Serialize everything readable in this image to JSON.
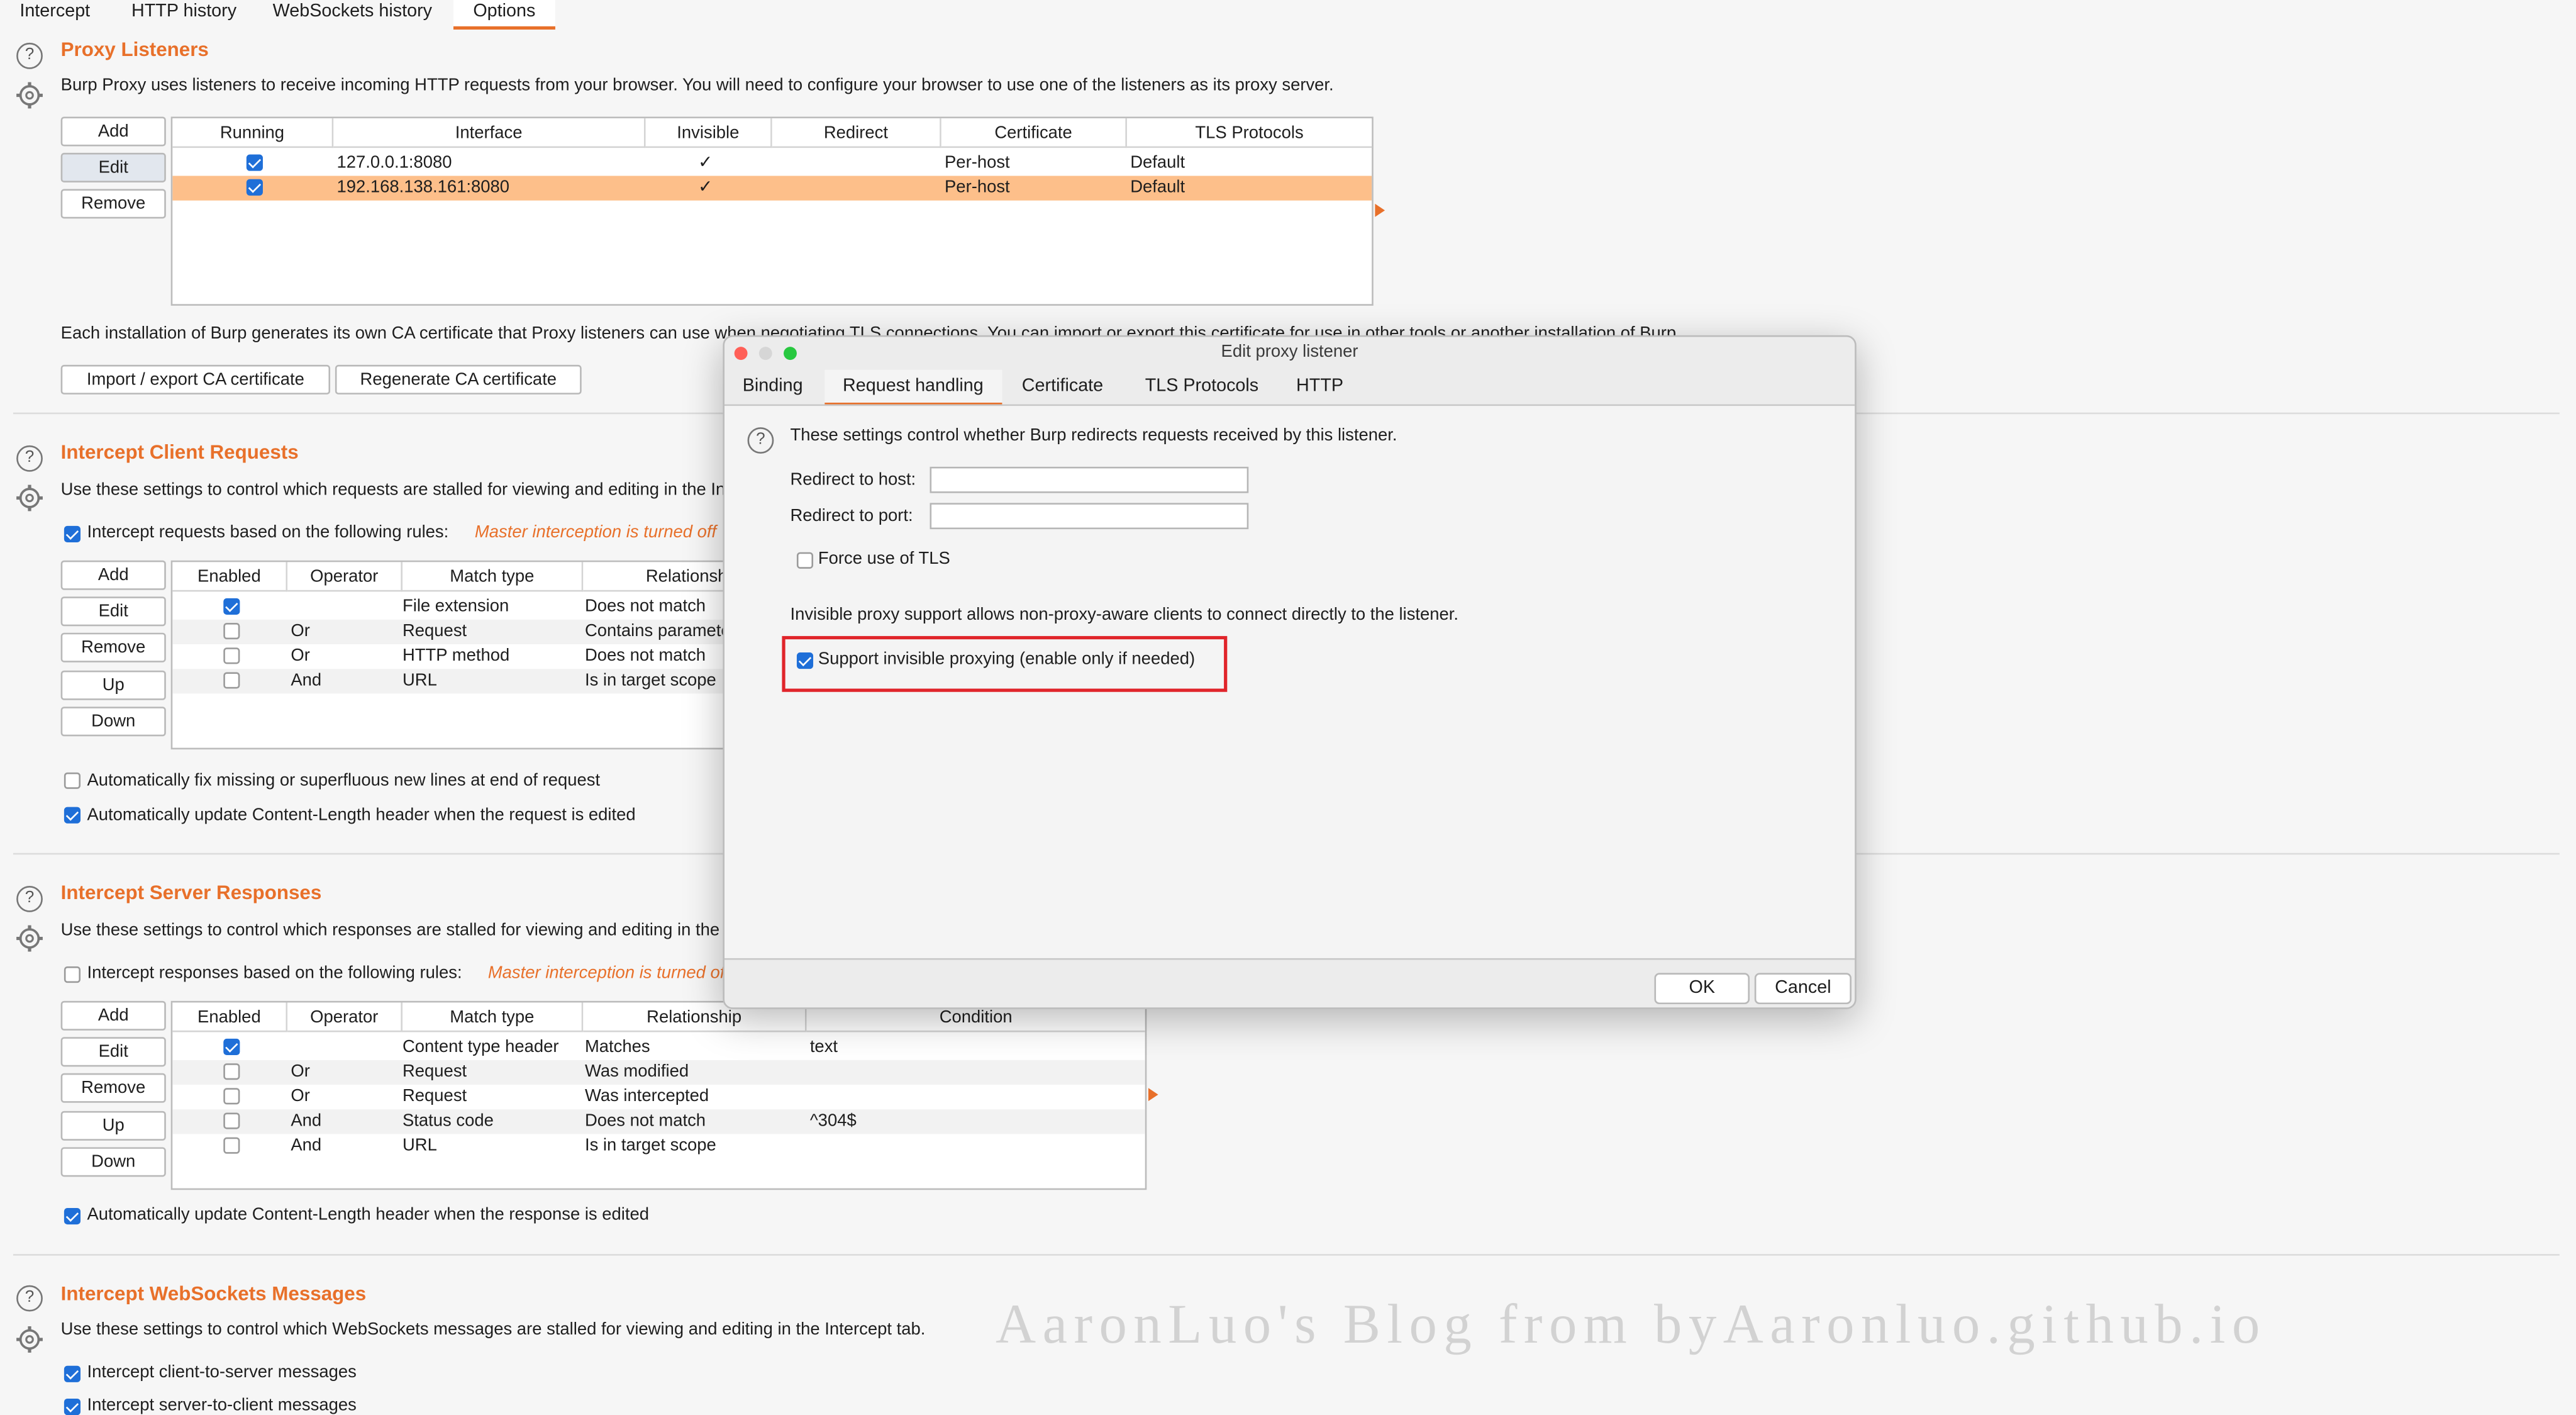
{
  "tabs": [
    "Intercept",
    "HTTP history",
    "WebSockets history",
    "Options"
  ],
  "proxy_listeners": {
    "title": "Proxy Listeners",
    "description": "Burp Proxy uses listeners to receive incoming HTTP requests from your browser. You will need to configure your browser to use one of the listeners as its proxy server.",
    "buttons": [
      "Add",
      "Edit",
      "Remove"
    ],
    "columns": [
      "Running",
      "Interface",
      "Invisible",
      "Redirect",
      "Certificate",
      "TLS Protocols"
    ],
    "rows": [
      {
        "running": true,
        "interface": "127.0.0.1:8080",
        "invisible": "✓",
        "redirect": "",
        "certificate": "Per-host",
        "tls": "Default"
      },
      {
        "running": true,
        "interface": "192.168.138.161:8080",
        "invisible": "✓",
        "redirect": "",
        "certificate": "Per-host",
        "tls": "Default"
      }
    ],
    "ca_text": "Each installation of Burp generates its own CA certificate that Proxy listeners can use when negotiating TLS connections. You can import or export this certificate for use in other tools or another installation of Burp.",
    "import_export_label": "Import / export CA certificate",
    "regenerate_label": "Regenerate CA certificate"
  },
  "intercept_client": {
    "title": "Intercept Client Requests",
    "description": "Use these settings to control which requests are stalled for viewing and editing in the Intercept tab.",
    "rule_label": "Intercept requests based on the following rules:",
    "master_note": "Master interception is turned off",
    "buttons": [
      "Add",
      "Edit",
      "Remove",
      "Up",
      "Down"
    ],
    "columns": [
      "Enabled",
      "Operator",
      "Match type",
      "Relationship"
    ],
    "rows": [
      {
        "enabled": true,
        "operator": "",
        "match": "File extension",
        "rel": "Does not match"
      },
      {
        "enabled": false,
        "operator": "Or",
        "match": "Request",
        "rel": "Contains parameters"
      },
      {
        "enabled": false,
        "operator": "Or",
        "match": "HTTP method",
        "rel": "Does not match"
      },
      {
        "enabled": false,
        "operator": "And",
        "match": "URL",
        "rel": "Is in target scope"
      }
    ],
    "fix_newlines": "Automatically fix missing or superfluous new lines at end of request",
    "update_cl": "Automatically update Content-Length header when the request is edited"
  },
  "intercept_server": {
    "title": "Intercept Server Responses",
    "description": "Use these settings to control which responses are stalled for viewing and editing in the Intercept tab.",
    "rule_label": "Intercept responses based on the following rules:",
    "master_note": "Master interception is turned off",
    "buttons": [
      "Add",
      "Edit",
      "Remove",
      "Up",
      "Down"
    ],
    "columns": [
      "Enabled",
      "Operator",
      "Match type",
      "Relationship",
      "Condition"
    ],
    "rows": [
      {
        "enabled": true,
        "operator": "",
        "match": "Content type header",
        "rel": "Matches",
        "cond": "text"
      },
      {
        "enabled": false,
        "operator": "Or",
        "match": "Request",
        "rel": "Was modified",
        "cond": ""
      },
      {
        "enabled": false,
        "operator": "Or",
        "match": "Request",
        "rel": "Was intercepted",
        "cond": ""
      },
      {
        "enabled": false,
        "operator": "And",
        "match": "Status code",
        "rel": "Does not match",
        "cond": "^304$"
      },
      {
        "enabled": false,
        "operator": "And",
        "match": "URL",
        "rel": "Is in target scope",
        "cond": ""
      }
    ],
    "update_cl": "Automatically update Content-Length header when the response is edited"
  },
  "intercept_ws": {
    "title": "Intercept WebSockets Messages",
    "description": "Use these settings to control which WebSockets messages are stalled for viewing and editing in the Intercept tab.",
    "client_to_server": "Intercept client-to-server messages",
    "server_to_client": "Intercept server-to-client messages"
  },
  "dialog": {
    "title": "Edit proxy listener",
    "tabs": [
      "Binding",
      "Request handling",
      "Certificate",
      "TLS Protocols",
      "HTTP"
    ],
    "help_text": "These settings control whether Burp redirects requests received by this listener.",
    "redirect_host_label": "Redirect to host:",
    "redirect_host_value": "",
    "redirect_port_label": "Redirect to port:",
    "redirect_port_value": "",
    "force_tls": "Force use of TLS",
    "invisible_info": "Invisible proxy support allows non-proxy-aware clients to connect directly to the listener.",
    "support_invisible": "Support invisible proxying (enable only if needed)",
    "ok_label": "OK",
    "cancel_label": "Cancel"
  },
  "watermark": "AaronLuo's Blog from byAaronluo.github.io",
  "colors": {
    "accent": "#e8702a",
    "highlight_row": "#fdbf8a",
    "checkbox": "#1f6fd8",
    "annotation": "#e0242a"
  }
}
